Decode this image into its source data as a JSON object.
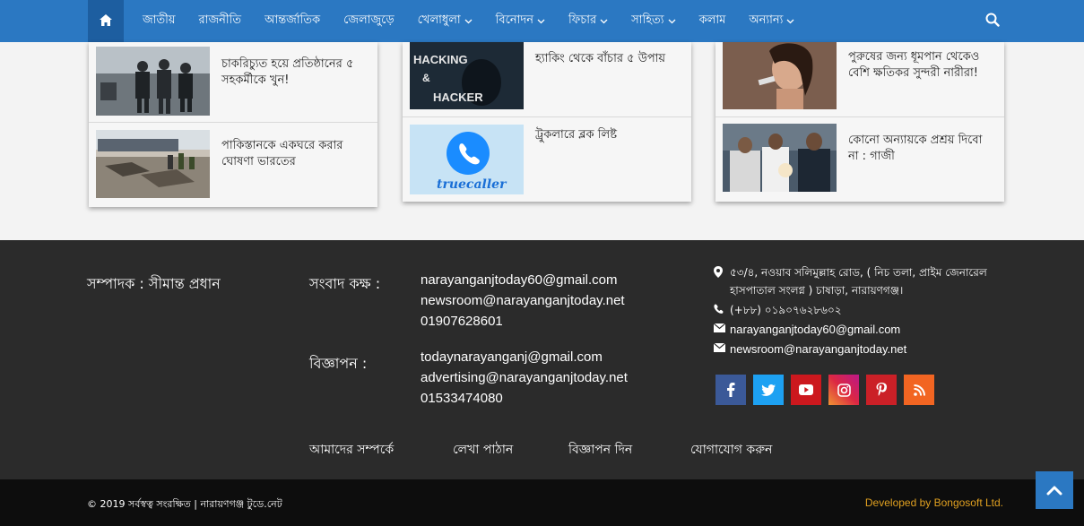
{
  "nav": {
    "home_icon": "home-icon",
    "items": [
      {
        "label": "জাতীয়",
        "dropdown": false
      },
      {
        "label": "রাজনীতি",
        "dropdown": false
      },
      {
        "label": "আন্তর্জাতিক",
        "dropdown": false
      },
      {
        "label": "জেলাজুড়ে",
        "dropdown": false
      },
      {
        "label": "খেলাধুলা",
        "dropdown": true
      },
      {
        "label": "বিনোদন",
        "dropdown": true
      },
      {
        "label": "ফিচার",
        "dropdown": true
      },
      {
        "label": "সাহিত্য",
        "dropdown": true
      },
      {
        "label": "কলাম",
        "dropdown": false
      },
      {
        "label": "অন্যান্য",
        "dropdown": true
      }
    ],
    "search_icon": "search-icon",
    "accent": "#2b78c2"
  },
  "cards": [
    {
      "items": [
        {
          "title": "চাকরিচ্যুত হয়ে প্রতিষ্ঠানের ৫ সহকর্মীকে খুন!"
        },
        {
          "title": "পাকিস্তানকে একঘরে করার ঘোষণা ভারতের"
        }
      ]
    },
    {
      "items": [
        {
          "title": "হ্যাকিং থেকে বাঁচার ৫ উপায়",
          "thumb_text": [
            "HACKING",
            "&",
            "HACKER"
          ]
        },
        {
          "title": "ট্রুকলারে ব্লক লিষ্ট",
          "thumb_text": [
            "truecaller"
          ]
        }
      ]
    },
    {
      "items": [
        {
          "title": "পুরুষের জন্য ধূমপান থেকেও বেশি ক্ষতিকর সুন্দরী নারীরা!"
        },
        {
          "title": "কোনো অন্যায়কে প্রশ্রয় দিবো না : গাজী"
        }
      ]
    }
  ],
  "footer": {
    "editor": "সম্পাদক : সীমান্ত প্রধান",
    "newsroom_label": "সংবাদ কক্ষ :",
    "newsroom_lines": [
      "narayanganjtoday60@gmail.com",
      "newsroom@narayanganjtoday.net",
      "01907628601"
    ],
    "ads_label": "বিজ্ঞাপন :",
    "ads_lines": [
      "todaynarayanganj@gmail.com",
      "advertising@narayanganjtoday.net",
      "01533474080"
    ],
    "address": "৫৩/৪, নওয়াব সলিমুল্লাহ রোড, ( নিচ তলা, প্রাইম জেনারেল হাসপাতাল সংলগ্ন ) চাষাড়া, নারায়ণগঞ্জ।",
    "phone": "(+৮৮) ০১৯০৭৬২৮৬০২",
    "email1": "narayanganjtoday60@gmail.com",
    "email2": "newsroom@narayanganjtoday.net",
    "social": [
      {
        "name": "facebook-icon",
        "glyph": "f",
        "color": "#3b5998"
      },
      {
        "name": "twitter-icon",
        "glyph": "t",
        "color": "#1da1f2"
      },
      {
        "name": "youtube-icon",
        "glyph": "▶",
        "color": "#cc181e"
      },
      {
        "name": "instagram-icon",
        "glyph": "◎",
        "color": "#e1306c"
      },
      {
        "name": "pinterest-icon",
        "glyph": "p",
        "color": "#cb2027"
      },
      {
        "name": "rss-icon",
        "glyph": "\\",
        "color": "#f26522"
      }
    ],
    "links": [
      "আমাদের সম্পর্কে",
      "লেখা পাঠান",
      "বিজ্ঞাপন দিন",
      "যোগাযোগ করুন"
    ]
  },
  "bottom": {
    "copyright": "© 2019 সর্বস্বত্ব সংরক্ষিত | নারায়ণগঞ্জ টুডে.নেট",
    "developer": "Developed by Bongosoft Ltd."
  }
}
